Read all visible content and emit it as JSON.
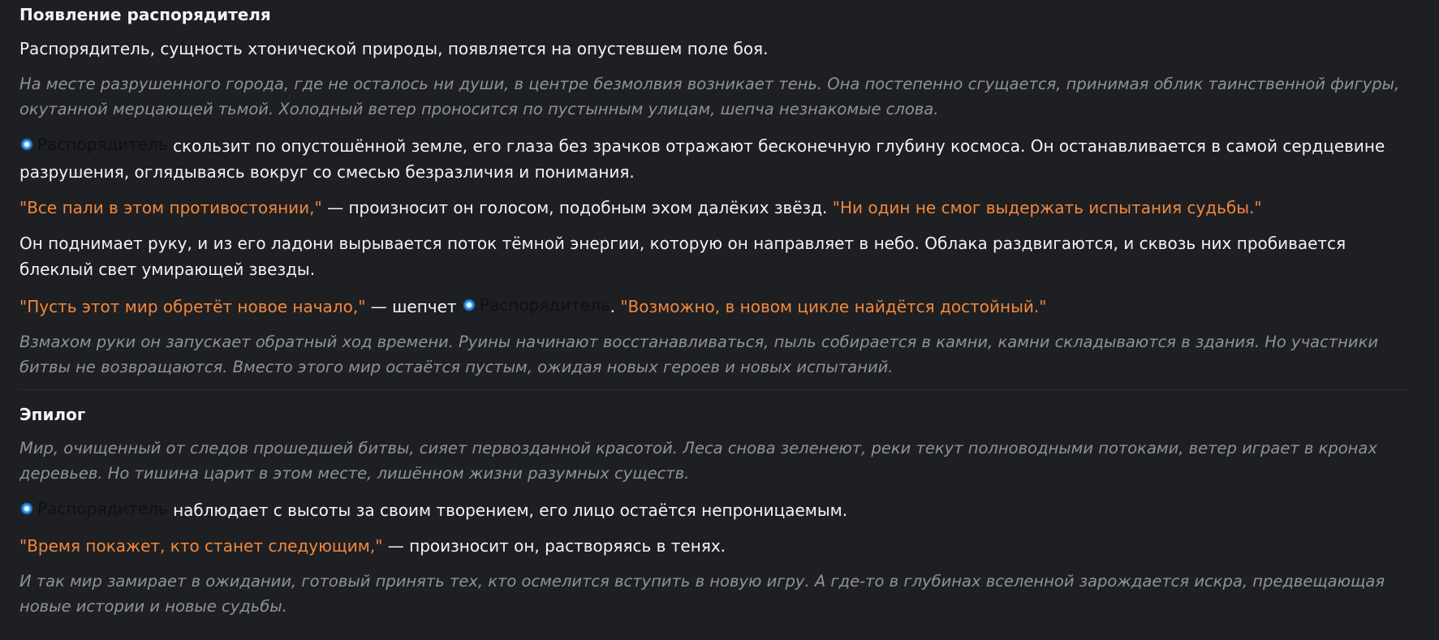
{
  "section1": {
    "title": "Появление распорядителя",
    "intro": "Распорядитель, сущность хтонической природы, появляется на опустевшем поле боя.",
    "narration1": "На месте разрушенного города, где не осталось ни души, в центре безмолвия возникает тень. Она постепенно сгущается, принимая облик таинственной фигуры, окутанной мерцающей тьмой. Холодный ветер проносится по пустынным улицам, шепча незнакомые слова.",
    "action1_text": "скользит по опустошённой земле, его глаза без зрачков отражают бесконечную глубину космоса. Он останавливается в самой сердцевине разрушения, оглядываясь вокруг со смесью безразличия и понимания.",
    "quote1": "\"Все пали в этом противостоянии,\"",
    "quote1_after": " — произносит он голосом, подобным эхом далёких звёзд. ",
    "quote2": "\"Ни один не смог выдержать испытания судьбы.\"",
    "action2": "Он поднимает руку, и из его ладони вырывается поток тёмной энергии, которую он направляет в небо. Облака раздвигаются, и сквозь них пробивается блеклый свет умирающей звезды.",
    "quote3": "\"Пусть этот мир обретёт новое начало,\"",
    "quote3_after": " — шепчет ",
    "quote3_period": ". ",
    "quote4": "\"Возможно, в новом цикле найдётся достойный.\"",
    "narration2": "Взмахом руки он запускает обратный ход времени. Руины начинают восстанавливаться, пыль собирается в камни, камни складываются в здания. Но участники битвы не возвращаются. Вместо этого мир остаётся пустым, ожидая новых героев и новых испытаний."
  },
  "section2": {
    "title": "Эпилог",
    "narration1": "Мир, очищенный от следов прошедшей битвы, сияет первозданной красотой. Леса снова зеленеют, реки текут полноводными потоками, ветер играет в кронах деревьев. Но тишина царит в этом месте, лишённом жизни разумных существ.",
    "action1_text": "наблюдает с высоты за своим творением, его лицо остаётся непроницаемым.",
    "quote1": "\"Время покажет, кто станет следующим,\"",
    "quote1_after": " — произносит он, растворяясь в тенях.",
    "narration2": "И так мир замирает в ожидании, готовый принять тех, кто осмелится вступить в новую игру. А где-то в глубинах вселенной зарождается искра, предвещающая новые истории и новые судьбы."
  },
  "mention": {
    "name": "Распорядитель",
    "icon": "blue-orb-icon"
  },
  "colors": {
    "background": "#1e1f22",
    "text": "#f2f3f5",
    "narration": "#8e9297",
    "quote": "#f0883e"
  }
}
